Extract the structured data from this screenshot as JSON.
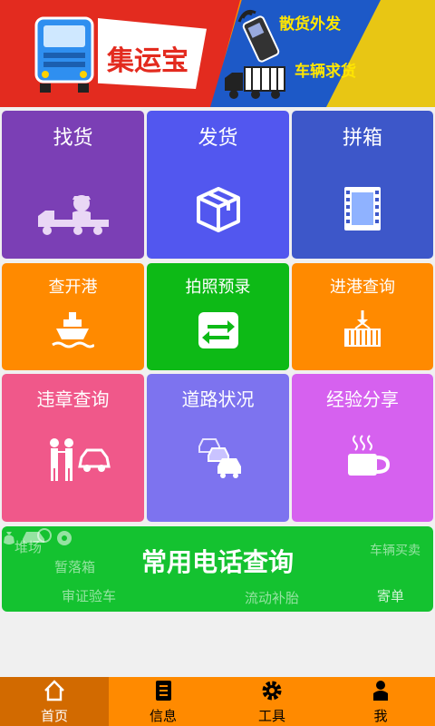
{
  "banner": {
    "app_name": "集运宝",
    "tag_bulk": "散货外发",
    "tag_vehicle": "车辆求货"
  },
  "tiles": {
    "find_goods": "找货",
    "send_goods": "发货",
    "consolidate": "拼箱",
    "port_open": "查开港",
    "photo_record": "拍照预录",
    "port_entry": "进港查询",
    "violation": "违章查询",
    "road_status": "道路状况",
    "experience": "经验分享"
  },
  "phone_banner": {
    "title": "常用电话查询",
    "items": [
      "堆场",
      "暂落箱",
      "车辆买卖",
      "审证验车",
      "流动补胎",
      "寄单"
    ]
  },
  "nav": {
    "items": [
      "首页",
      "信息",
      "工具",
      "我"
    ],
    "active": "首页"
  },
  "colors": {
    "purple": "#7b3fb5",
    "blue": "#5257ef",
    "dark_blue": "#3d57c9",
    "orange": "#ff8a00",
    "green": "#0dba16",
    "pink": "#f0588a",
    "periwinkle": "#7d73ef",
    "violet": "#d661ef",
    "bar_green": "#14c230"
  }
}
